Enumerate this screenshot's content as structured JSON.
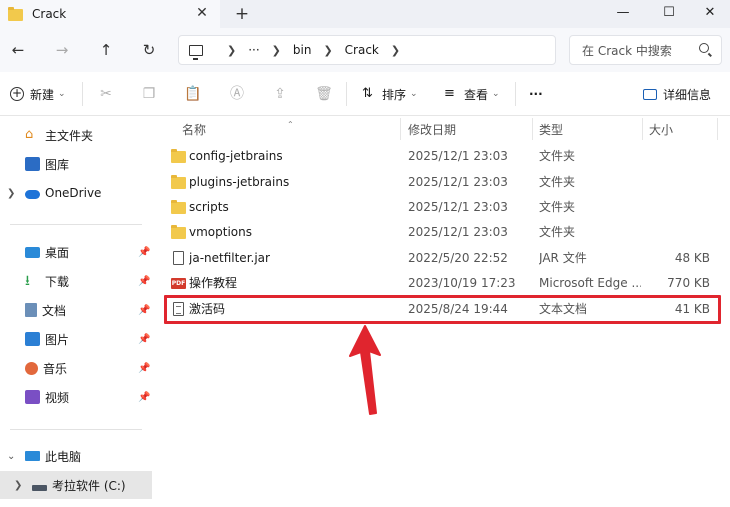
{
  "window": {
    "tab_title": "Crack",
    "tab_close": "✕",
    "new_tab": "+",
    "minimize": "—",
    "maximize": "☐",
    "close": "✕"
  },
  "nav": {
    "back": "←",
    "forward": "→",
    "up": "↑",
    "refresh": "↻",
    "breadcrumb": [
      "···",
      "bin",
      "Crack"
    ],
    "search_placeholder": "在 Crack 中搜索"
  },
  "toolbar": {
    "new_label": "新建",
    "sort_label": "排序",
    "view_label": "查看",
    "more_label": "···",
    "details_label": "详细信息"
  },
  "sidebar": {
    "items": [
      {
        "label": "主文件夹",
        "icon": "home-icon"
      },
      {
        "label": "图库",
        "icon": "gallery-icon"
      },
      {
        "label": "OneDrive",
        "icon": "cloud-icon"
      },
      {
        "label": "桌面",
        "icon": "desktop-icon"
      },
      {
        "label": "下载",
        "icon": "download-icon"
      },
      {
        "label": "文档",
        "icon": "documents-icon"
      },
      {
        "label": "图片",
        "icon": "pictures-icon"
      },
      {
        "label": "音乐",
        "icon": "music-icon"
      },
      {
        "label": "视频",
        "icon": "videos-icon"
      },
      {
        "label": "此电脑",
        "icon": "pc-icon"
      },
      {
        "label": "考拉软件 (C:)",
        "icon": "drive-icon"
      }
    ]
  },
  "columns": {
    "name": "名称",
    "date": "修改日期",
    "type": "类型",
    "size": "大小"
  },
  "files": [
    {
      "name": "config-jetbrains",
      "date": "2025/12/1 23:03",
      "type": "文件夹",
      "size": "",
      "icon": "folder-icon"
    },
    {
      "name": "plugins-jetbrains",
      "date": "2025/12/1 23:03",
      "type": "文件夹",
      "size": "",
      "icon": "folder-icon"
    },
    {
      "name": "scripts",
      "date": "2025/12/1 23:03",
      "type": "文件夹",
      "size": "",
      "icon": "folder-icon"
    },
    {
      "name": "vmoptions",
      "date": "2025/12/1 23:03",
      "type": "文件夹",
      "size": "",
      "icon": "folder-icon"
    },
    {
      "name": "ja-netfilter.jar",
      "date": "2022/5/20 22:52",
      "type": "JAR 文件",
      "size": "48 KB",
      "icon": "jar-file-icon"
    },
    {
      "name": "操作教程",
      "date": "2023/10/19 17:23",
      "type": "Microsoft Edge ...",
      "size": "770 KB",
      "icon": "pdf-icon"
    },
    {
      "name": "激活码",
      "date": "2025/8/24 19:44",
      "type": "文本文档",
      "size": "41 KB",
      "icon": "text-file-icon"
    }
  ],
  "annotation_color": "#e0252e"
}
